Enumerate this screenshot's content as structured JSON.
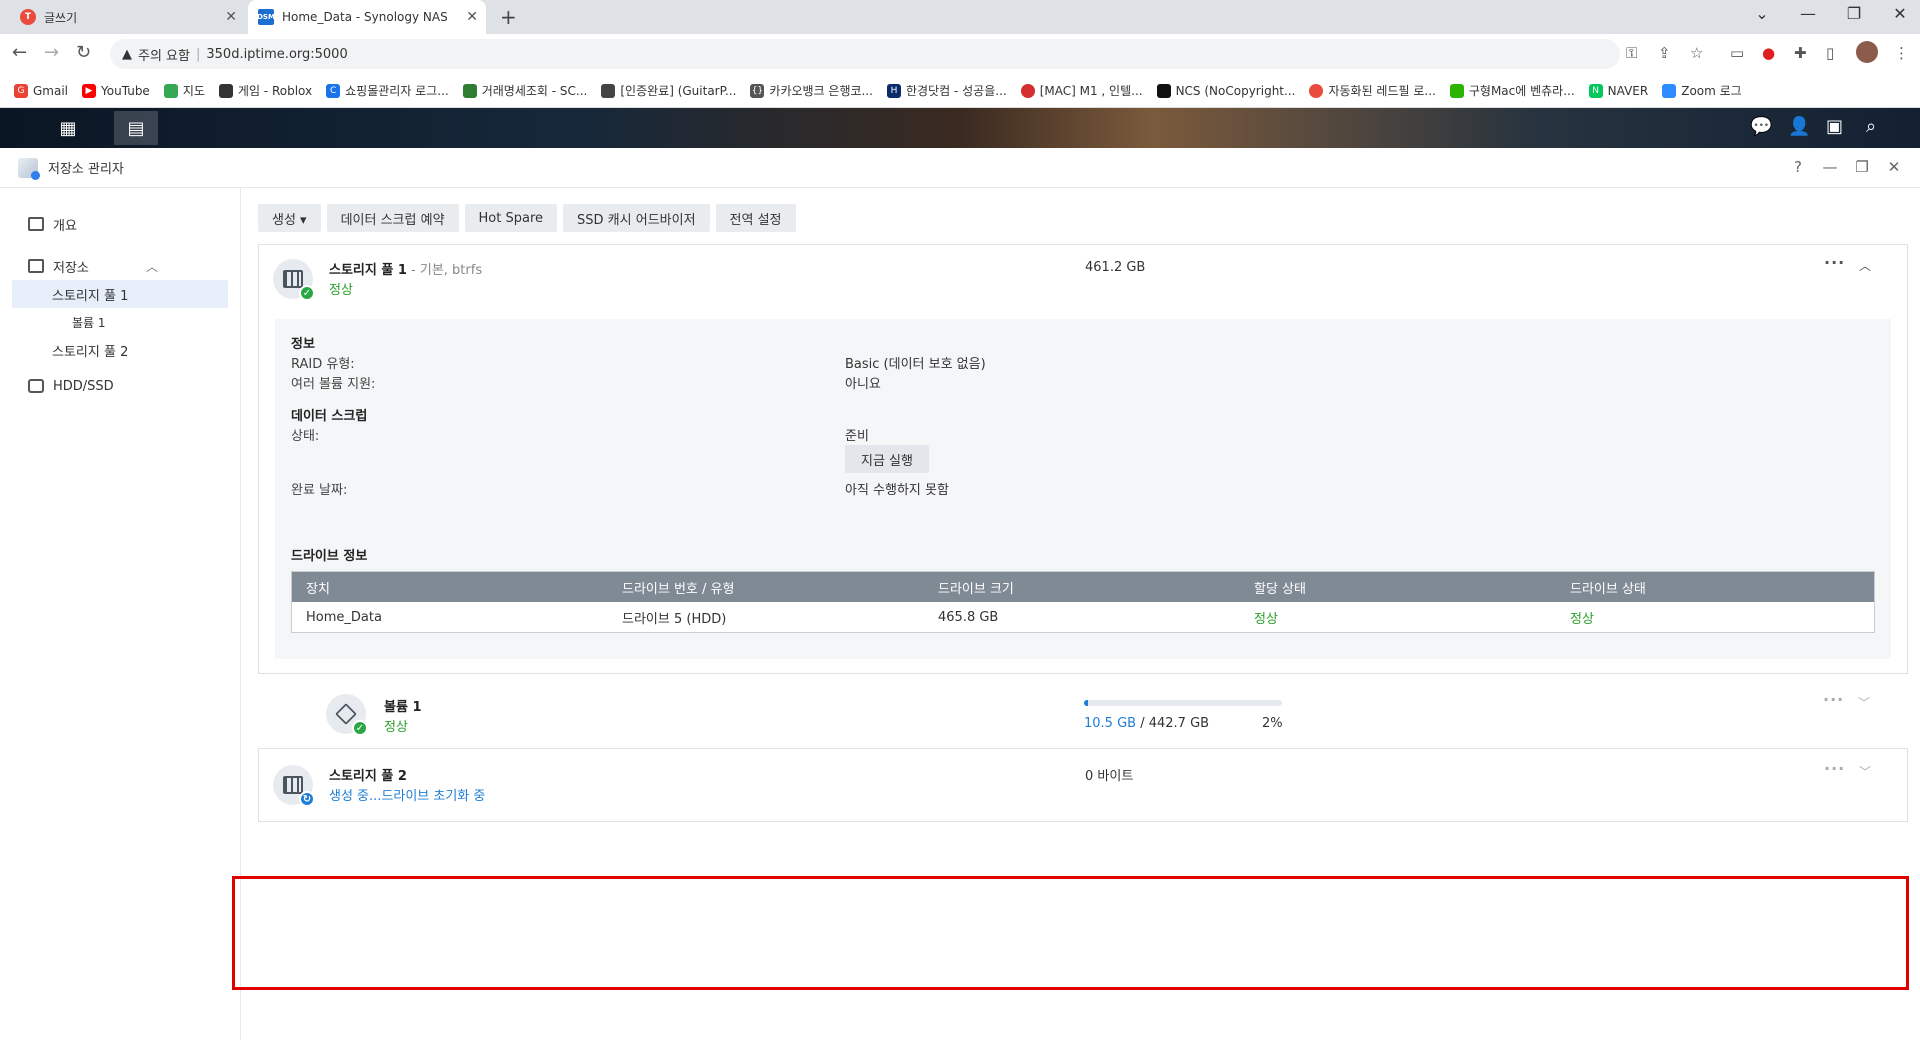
{
  "browser": {
    "tabs": [
      {
        "title": "글쓰기",
        "favicon_color": "#ea4b3c"
      },
      {
        "title": "Home_Data - Synology NAS",
        "favicon_color": "#1b6fd0",
        "favicon_text": "DSM"
      }
    ],
    "window_controls": {
      "chevron": "⌄",
      "minimize": "—",
      "restore": "❐",
      "close": "✕"
    },
    "address": {
      "warning": "주의 요함",
      "url": "350d.iptime.org:5000"
    },
    "bookmarks": [
      {
        "label": "Gmail",
        "color": "#ea4335"
      },
      {
        "label": "YouTube",
        "color": "#ff0000"
      },
      {
        "label": "지도",
        "color": "#34a853"
      },
      {
        "label": "게임 - Roblox",
        "color": "#333333"
      },
      {
        "label": "쇼핑몰관리자 로그...",
        "color": "#1a73e8"
      },
      {
        "label": "거래명세조회 - SC...",
        "color": "#2e7d32"
      },
      {
        "label": "[인증완료] (GuitarP...",
        "color": "#444444"
      },
      {
        "label": "카카오뱅크 은행코...",
        "color": "#555555"
      },
      {
        "label": "한경닷컴 - 성공을...",
        "color": "#0b2a6b"
      },
      {
        "label": "[MAC] M1 , 인텔...",
        "color": "#d32f2f"
      },
      {
        "label": "NCS (NoCopyright...",
        "color": "#111111"
      },
      {
        "label": "자동화된 레드필 로...",
        "color": "#ea4b3c"
      },
      {
        "label": "구형Mac에 벤츄라...",
        "color": "#2db400"
      },
      {
        "label": "NAVER",
        "color": "#03c75a"
      },
      {
        "label": "Zoom 로그",
        "color": "#2d8cff"
      }
    ]
  },
  "app": {
    "title": "저장소 관리자",
    "sidebar": [
      {
        "label": "개요"
      },
      {
        "label": "저장소"
      },
      {
        "label": "스토리지 풀 1"
      },
      {
        "label": "볼륨 1"
      },
      {
        "label": "스토리지 풀 2"
      },
      {
        "label": "HDD/SSD"
      }
    ],
    "toolbar": [
      "생성 ▾",
      "데이터 스크럽 예약",
      "Hot Spare",
      "SSD 캐시 어드바이저",
      "전역 설정"
    ],
    "pool1": {
      "title": "스토리지 풀 1",
      "meta": " - 기본, btrfs",
      "status": "정상",
      "size": "461.2 GB",
      "info_title": "정보",
      "raid_label": "RAID 유형:",
      "raid_value": "Basic (데이터 보호 없음)",
      "multi_label": "여러 볼륨 지원:",
      "multi_value": "아니요",
      "scrub_title": "데이터 스크럽",
      "state_label": "상태:",
      "state_value": "준비",
      "run_now": "지금 실행",
      "done_label": "완료 날짜:",
      "done_value": "아직 수행하지 못함",
      "drive_title": "드라이브 정보",
      "table_headers": [
        "장치",
        "드라이브 번호 / 유형",
        "드라이브 크기",
        "할당 상태",
        "드라이브 상태"
      ],
      "table_rows": [
        [
          "Home_Data",
          "드라이브 5 (HDD)",
          "465.8 GB",
          "정상",
          "정상"
        ]
      ]
    },
    "volume1": {
      "title": "볼륨 1",
      "status": "정상",
      "used": "10.5 GB",
      "total": " / 442.7 GB",
      "percent_text": "2%",
      "usage_fraction": 0.02
    },
    "pool2": {
      "title": "스토리지 풀 2",
      "status": "생성 중...드라이브 초기화 중",
      "size": "0 바이트"
    }
  }
}
